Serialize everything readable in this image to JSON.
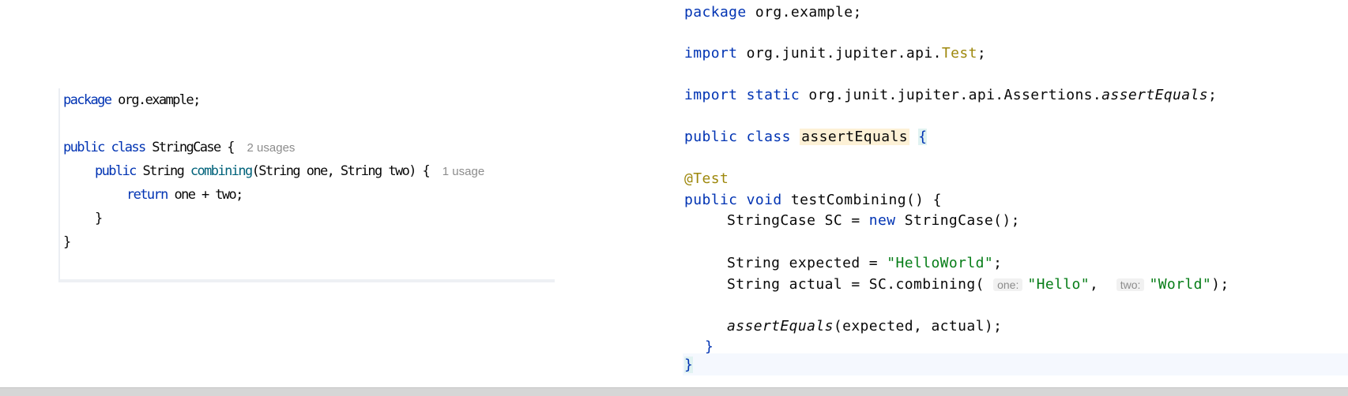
{
  "left_editor": {
    "package_kw": "package",
    "package_name": " org.example;",
    "public_kw": "public",
    "class_kw": "class",
    "class_name": " StringCase { ",
    "class_usages": "2 usages",
    "method_public": "public",
    "method_type": " String ",
    "method_name": "combining",
    "method_params": "(String one, String two) { ",
    "method_usages": "1 usage",
    "return_kw": "return",
    "return_expr": " one + two;",
    "close_method": "}",
    "close_class": "}"
  },
  "right_editor": {
    "package_kw": "package",
    "package_name": " org.example;",
    "import_kw": "import",
    "import_pkg": " org.junit.jupiter.api.",
    "import_test": "Test",
    "semicolon": ";",
    "import_static_kw": "import static",
    "static_pkg": " org.junit.jupiter.api.Assertions.",
    "static_method": "assertEquals",
    "public_kw": "public",
    "class_kw": "class",
    "class_name": "assertEquals",
    "open_brace": "{",
    "annotation": "@Test",
    "method_public": "public",
    "void_kw": "void",
    "method_sig": " testCombining() {",
    "sc_type": "StringCase SC = ",
    "new_kw": "new",
    "sc_ctor": " StringCase();",
    "expected_decl": "String expected = ",
    "expected_value": "\"HelloWorld\"",
    "actual_decl": "String actual = SC.combining( ",
    "hint_one": "one:",
    "arg_one": "\"Hello\"",
    "comma": ", ",
    "hint_two": "two:",
    "arg_two": "\"World\"",
    "close_call": ");",
    "assert_call": "assertEquals",
    "assert_args": "(expected, actual);",
    "close_method": "}",
    "close_class": "}"
  },
  "colors": {
    "keyword": "#0033b3",
    "string": "#067d17",
    "annotation": "#9e880d",
    "hint": "#8c8c8c",
    "method_decl": "#00627a"
  }
}
